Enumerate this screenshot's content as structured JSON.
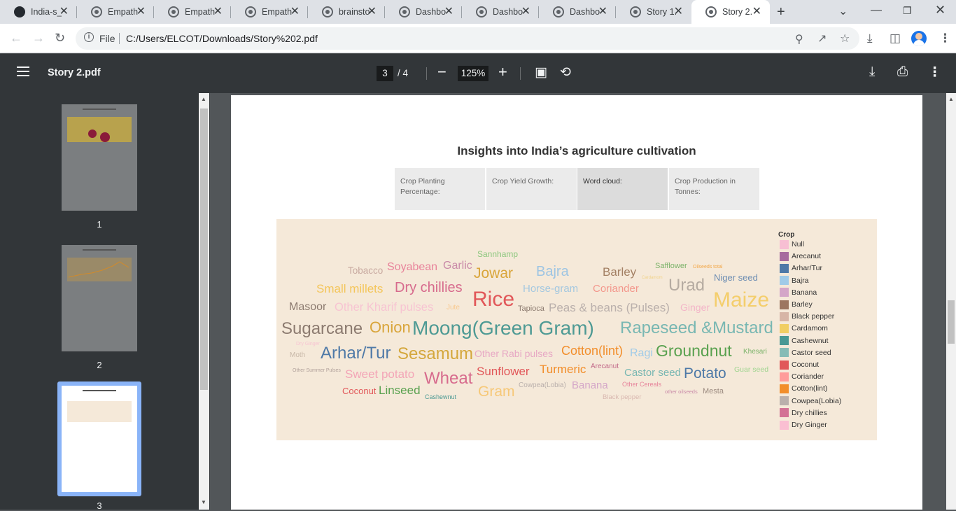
{
  "browser": {
    "tabs": [
      {
        "title": "India-s_",
        "icon": "github-icon"
      },
      {
        "title": "Empath",
        "icon": "globe-icon"
      },
      {
        "title": "Empath",
        "icon": "globe-icon"
      },
      {
        "title": "Empath",
        "icon": "globe-icon"
      },
      {
        "title": "brainsto",
        "icon": "globe-icon"
      },
      {
        "title": "Dashbo",
        "icon": "globe-icon"
      },
      {
        "title": "Dashbo",
        "icon": "globe-icon"
      },
      {
        "title": "Dashbo",
        "icon": "globe-icon"
      },
      {
        "title": "Story 1.",
        "icon": "globe-icon"
      },
      {
        "title": "Story 2.",
        "icon": "globe-icon"
      }
    ],
    "address": {
      "scheme": "File",
      "url": "C:/Users/ELCOT/Downloads/Story%202.pdf"
    }
  },
  "pdf": {
    "title": "Story 2.pdf",
    "current_page": "3",
    "total_pages": "/  4",
    "zoom": "125%"
  },
  "thumbnails": [
    {
      "label": "1"
    },
    {
      "label": "2"
    },
    {
      "label": "3"
    }
  ],
  "page": {
    "title": "Insights into India’s agriculture cultivation",
    "story_tabs": [
      {
        "label": "Crop Planting Percentage:"
      },
      {
        "label": "Crop Yield Growth:"
      },
      {
        "label": "Word cloud:"
      },
      {
        "label": "Crop Production in Tonnes:"
      }
    ],
    "wordcloud": {
      "words": [
        {
          "text": "Sannhamp",
          "color": "#8cc77e"
        },
        {
          "text": "Tobacco",
          "color": "#c8a9a0"
        },
        {
          "text": "Soyabean",
          "color": "#e8829a"
        },
        {
          "text": "Garlic",
          "color": "#c98aa8"
        },
        {
          "text": "Jowar",
          "color": "#d9a53a"
        },
        {
          "text": "Bajra",
          "color": "#9ec5e3"
        },
        {
          "text": "Barley",
          "color": "#a38064"
        },
        {
          "text": "Safflower",
          "color": "#7cb36a"
        },
        {
          "text": "Oilseeds total",
          "color": "#f2a84a"
        },
        {
          "text": "Cardamom",
          "color": "#f1d38a"
        },
        {
          "text": "Niger seed",
          "color": "#6e8eb3"
        },
        {
          "text": "Small millets",
          "color": "#f4c55a"
        },
        {
          "text": "Dry chillies",
          "color": "#d76b8d"
        },
        {
          "text": "Horse-gram",
          "color": "#a4c8e0"
        },
        {
          "text": "Coriander",
          "color": "#f3978c"
        },
        {
          "text": "Urad",
          "color": "#b5aba1"
        },
        {
          "text": "Masoor",
          "color": "#8c7b70"
        },
        {
          "text": "Other Kharif pulses",
          "color": "#f7c4d2"
        },
        {
          "text": "Jute",
          "color": "#f8c98e"
        },
        {
          "text": "Rice",
          "color": "#e15759"
        },
        {
          "text": "Tapioca",
          "color": "#8c7b70"
        },
        {
          "text": "Peas & beans (Pulses)",
          "color": "#bab0ac"
        },
        {
          "text": "Ginger",
          "color": "#f3b5c8"
        },
        {
          "text": "Maize",
          "color": "#f4ce6c"
        },
        {
          "text": "Sugarcane",
          "color": "#8c7b70"
        },
        {
          "text": "Onion",
          "color": "#d9a53a"
        },
        {
          "text": "Moong(Green Gram)",
          "color": "#4e9a94"
        },
        {
          "text": "Rapeseed &Mustard",
          "color": "#78b7b2"
        },
        {
          "text": "Dry Ginger",
          "color": "#f7c4d2"
        },
        {
          "text": "Moth",
          "color": "#c8b8a8"
        },
        {
          "text": "Arhar/Tur",
          "color": "#4e79a7"
        },
        {
          "text": "Sesamum",
          "color": "#d4a73c"
        },
        {
          "text": "Other Rabi pulses",
          "color": "#e7a8c4"
        },
        {
          "text": "Cotton(lint)",
          "color": "#f28e2b"
        },
        {
          "text": "Ragi",
          "color": "#a0cbe8"
        },
        {
          "text": "Groundnut",
          "color": "#59a14f"
        },
        {
          "text": "Khesari",
          "color": "#7cb36a"
        },
        {
          "text": "Other Summer Pulses",
          "color": "#b0a09a"
        },
        {
          "text": "Sweet potato",
          "color": "#f3a5b7"
        },
        {
          "text": "Wheat",
          "color": "#d76b8d"
        },
        {
          "text": "Sunflower",
          "color": "#e15759"
        },
        {
          "text": "Turmeric",
          "color": "#f28e2b"
        },
        {
          "text": "Arecanut",
          "color": "#c26b8a"
        },
        {
          "text": "Castor seed",
          "color": "#78b7b2"
        },
        {
          "text": "Potato",
          "color": "#4e79a7"
        },
        {
          "text": "Guar seed",
          "color": "#9fd48f"
        },
        {
          "text": "Coconut",
          "color": "#e15759"
        },
        {
          "text": "Linseed",
          "color": "#59a14f"
        },
        {
          "text": "Gram",
          "color": "#f6c878"
        },
        {
          "text": "Cowpea(Lobia)",
          "color": "#bab0ac"
        },
        {
          "text": "Banana",
          "color": "#d4a6c8"
        },
        {
          "text": "Other Cereals",
          "color": "#e6839a"
        },
        {
          "text": "other oilseeds",
          "color": "#c98aa8"
        },
        {
          "text": "Mesta",
          "color": "#9c8b80"
        },
        {
          "text": "Cashewnut",
          "color": "#4e9a94"
        },
        {
          "text": "Black pepper",
          "color": "#d9b8b0"
        }
      ]
    },
    "legend": {
      "title": "Crop",
      "items": [
        {
          "label": "Null",
          "color": "#f7bfd3"
        },
        {
          "label": "Arecanut",
          "color": "#a76c9e"
        },
        {
          "label": "Arhar/Tur",
          "color": "#4e79a7"
        },
        {
          "label": "Bajra",
          "color": "#a0cbe8"
        },
        {
          "label": "Banana",
          "color": "#d4a6c8"
        },
        {
          "label": "Barley",
          "color": "#9d7660"
        },
        {
          "label": "Black pepper",
          "color": "#d7b5a6"
        },
        {
          "label": "Cardamom",
          "color": "#f1ce63"
        },
        {
          "label": "Cashewnut",
          "color": "#499894"
        },
        {
          "label": "Castor seed",
          "color": "#86bcb6"
        },
        {
          "label": "Coconut",
          "color": "#e15759"
        },
        {
          "label": "Coriander",
          "color": "#ff9d9a"
        },
        {
          "label": "Cotton(lint)",
          "color": "#f28e2b"
        },
        {
          "label": "Cowpea(Lobia)",
          "color": "#bab0ac"
        },
        {
          "label": "Dry chillies",
          "color": "#d37295"
        },
        {
          "label": "Dry Ginger",
          "color": "#fabfd2"
        }
      ]
    }
  }
}
